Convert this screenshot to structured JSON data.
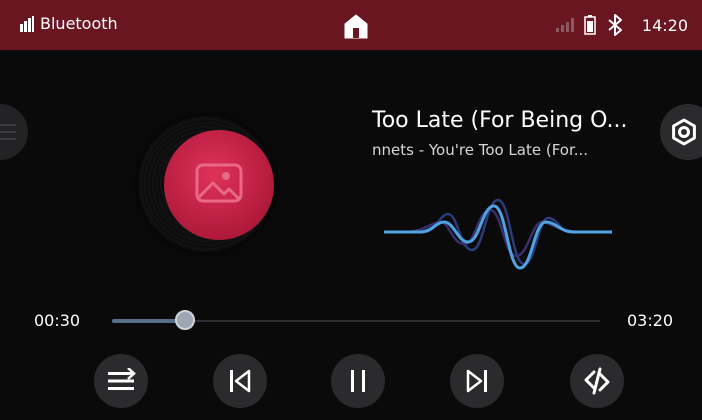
{
  "status_bar": {
    "source_label": "Bluetooth",
    "time": "14:20",
    "icons": [
      "signal-bars-icon",
      "home-icon",
      "cell-signal-icon",
      "battery-icon",
      "bluetooth-icon"
    ],
    "bg_color": "#6a1621"
  },
  "track": {
    "title": "Too Late (For Being O...",
    "artist": "nnets - You're Too Late (For..."
  },
  "playback": {
    "current_time": "00:30",
    "total_time": "03:20",
    "progress_fraction": 0.15
  },
  "controls": [
    "playlist-icon",
    "previous-icon",
    "pause-icon",
    "next-icon",
    "shuffle-icon"
  ],
  "side_buttons": {
    "left": "menu-icon",
    "right": "settings-icon"
  },
  "colors": {
    "accent": "#c2214a",
    "wave_blue": "#4ea3e0",
    "progress": "#56708a"
  }
}
